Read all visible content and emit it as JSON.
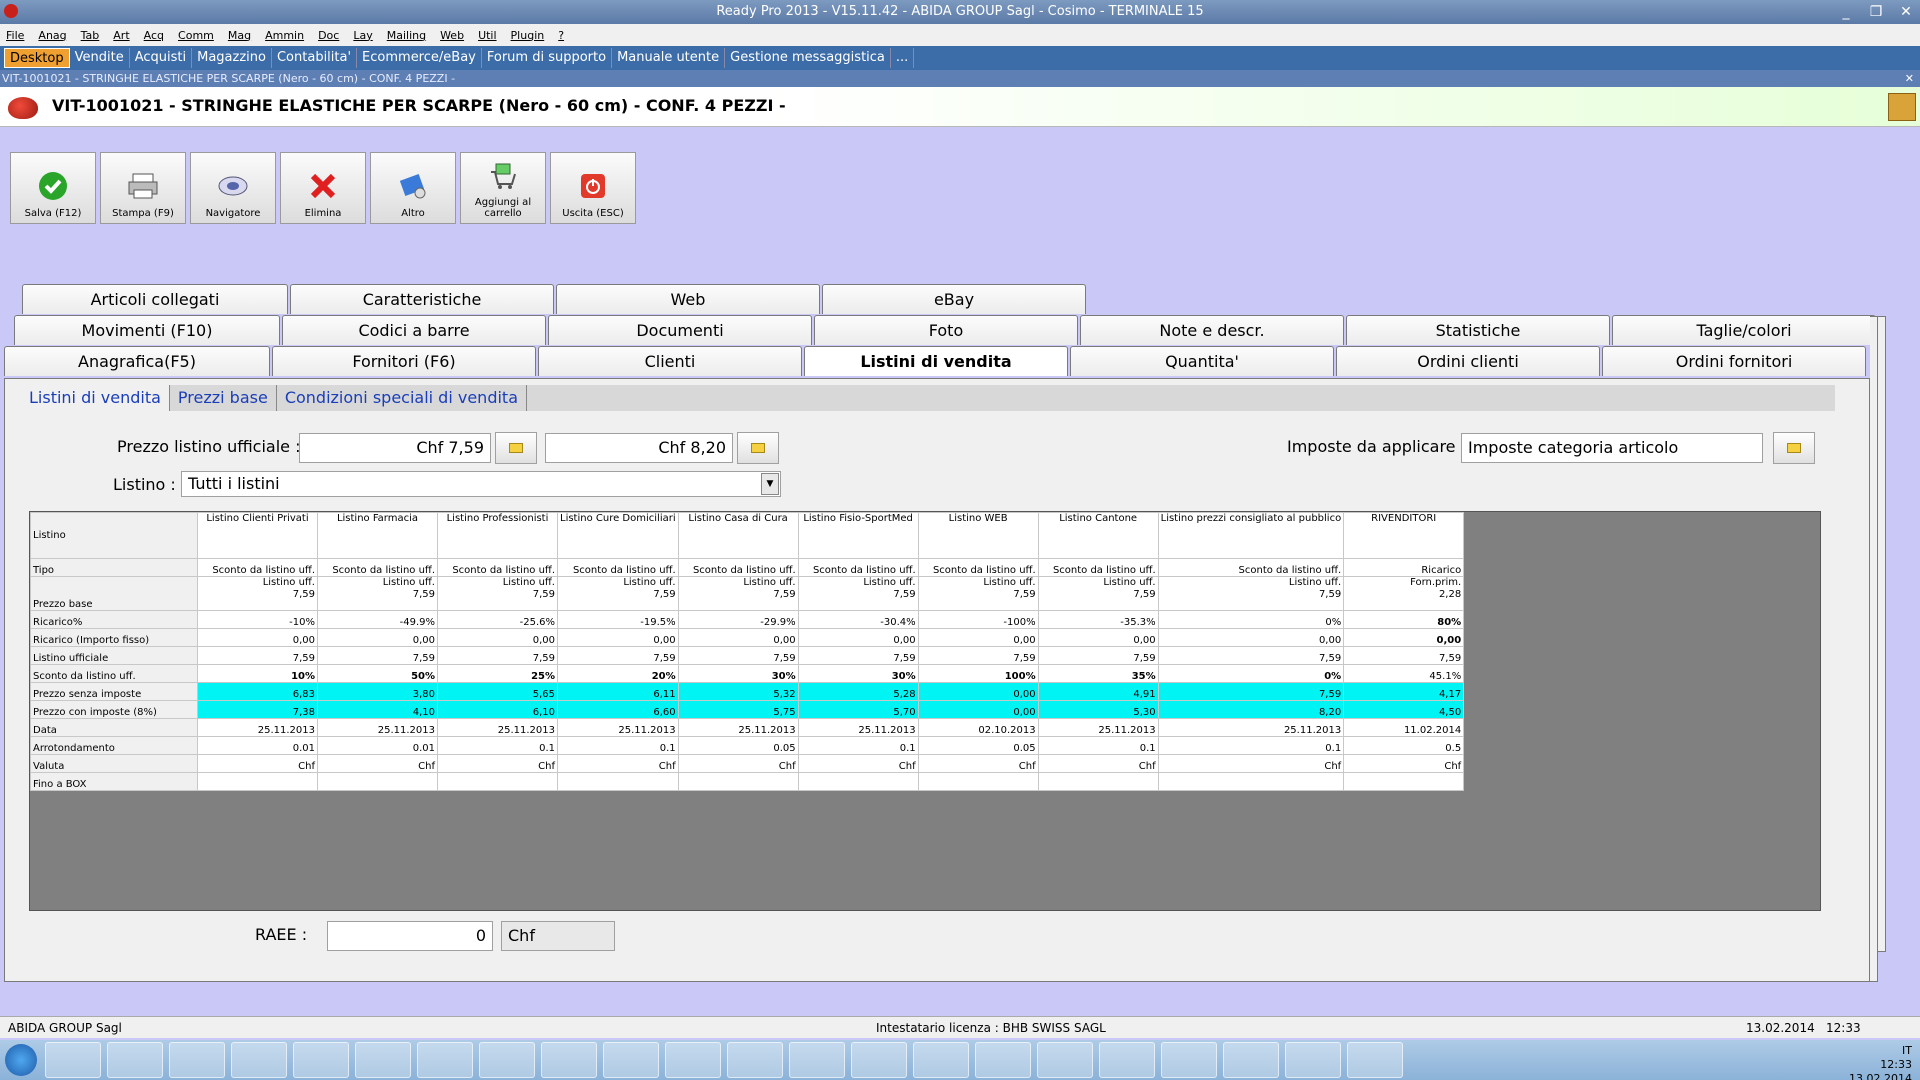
{
  "window": {
    "title": "Ready Pro 2013 - V15.11.42 - ABIDA GROUP Sagl - Cosimo - TERMINALE 15"
  },
  "menu": [
    "File",
    "Anag",
    "Tab",
    "Art",
    "Acq",
    "Comm",
    "Mag",
    "Ammin",
    "Doc",
    "Lay",
    "Mailing",
    "Web",
    "Util",
    "Plugin",
    "?"
  ],
  "quicktabs": [
    "Desktop",
    "Vendite",
    "Acquisti",
    "Magazzino",
    "Contabilita'",
    "Ecommerce/eBay",
    "Forum di supporto",
    "Manuale utente",
    "Gestione messaggistica",
    "..."
  ],
  "doc": {
    "small_title": "VIT-1001021 - STRINGHE ELASTICHE PER SCARPE (Nero - 60 cm) - CONF. 4 PEZZI -",
    "title": "VIT-1001021 - STRINGHE ELASTICHE PER SCARPE (Nero - 60 cm) - CONF. 4 PEZZI -"
  },
  "toolbar": [
    {
      "label": "Salva (F12)",
      "icon": "check-icon"
    },
    {
      "label": "Stampa (F9)",
      "icon": "printer-icon"
    },
    {
      "label": "Navigatore",
      "icon": "navigator-icon"
    },
    {
      "label": "Elimina",
      "icon": "delete-x-icon"
    },
    {
      "label": "Altro",
      "icon": "other-icon"
    },
    {
      "label": "Aggiungi al carrello",
      "icon": "cart-icon"
    },
    {
      "label": "Uscita (ESC)",
      "icon": "exit-icon"
    }
  ],
  "tabs": {
    "row1": [
      "Articoli collegati",
      "Caratteristiche",
      "Web",
      "eBay"
    ],
    "row2": [
      "Movimenti (F10)",
      "Codici a barre",
      "Documenti",
      "Foto",
      "Note e descr.",
      "Statistiche",
      "Taglie/colori"
    ],
    "row3": [
      "Anagrafica(F5)",
      "Fornitori (F6)",
      "Clienti",
      "Listini di vendita",
      "Quantita'",
      "Ordini clienti",
      "Ordini fornitori"
    ],
    "active": "Listini di vendita"
  },
  "subtabs": [
    "Listini di vendita",
    "Prezzi base",
    "Condizioni speciali di vendita"
  ],
  "form": {
    "prezzo_label": "Prezzo listino ufficiale :",
    "prezzo1": "Chf 7,59",
    "prezzo2": "Chf 8,20",
    "imposte_label": "Imposte da applicare :",
    "imposte_value": "Imposte categoria articolo",
    "listino_label": "Listino :",
    "listino_value": "Tutti i listini",
    "raee_label": "RAEE :",
    "raee_value": "0",
    "raee_currency": "Chf"
  },
  "grid": {
    "row_headers": [
      "Listino",
      "Tipo",
      "Prezzo base",
      "Ricarico%",
      "Ricarico (Importo fisso)",
      "Listino ufficiale",
      "Sconto da listino uff.",
      "Prezzo senza imposte",
      "Prezzo con imposte (8%)",
      "Data",
      "Arrotondamento",
      "Valuta",
      "Fino a BOX"
    ],
    "columns": [
      {
        "name": "Listino Clienti Privati",
        "tipo": "Sconto da listino uff.",
        "base1": "Listino uff.",
        "base2": "7,59",
        "ricarico": "-10%",
        "fisso": "0,00",
        "uff": "7,59",
        "sconto": "10%",
        "senza": "6,83",
        "con": "7,38",
        "data": "25.11.2013",
        "arr": "0.01",
        "valuta": "Chf"
      },
      {
        "name": "Listino Farmacia",
        "tipo": "Sconto da listino uff.",
        "base1": "Listino uff.",
        "base2": "7,59",
        "ricarico": "-49.9%",
        "fisso": "0,00",
        "uff": "7,59",
        "sconto": "50%",
        "senza": "3,80",
        "con": "4,10",
        "data": "25.11.2013",
        "arr": "0.01",
        "valuta": "Chf"
      },
      {
        "name": "Listino Professionisti",
        "tipo": "Sconto da listino uff.",
        "base1": "Listino uff.",
        "base2": "7,59",
        "ricarico": "-25.6%",
        "fisso": "0,00",
        "uff": "7,59",
        "sconto": "25%",
        "senza": "5,65",
        "con": "6,10",
        "data": "25.11.2013",
        "arr": "0.1",
        "valuta": "Chf"
      },
      {
        "name": "Listino Cure Domiciliari",
        "tipo": "Sconto da listino uff.",
        "base1": "Listino uff.",
        "base2": "7,59",
        "ricarico": "-19.5%",
        "fisso": "0,00",
        "uff": "7,59",
        "sconto": "20%",
        "senza": "6,11",
        "con": "6,60",
        "data": "25.11.2013",
        "arr": "0.1",
        "valuta": "Chf"
      },
      {
        "name": "Listino Casa di Cura",
        "tipo": "Sconto da listino uff.",
        "base1": "Listino uff.",
        "base2": "7,59",
        "ricarico": "-29.9%",
        "fisso": "0,00",
        "uff": "7,59",
        "sconto": "30%",
        "senza": "5,32",
        "con": "5,75",
        "data": "25.11.2013",
        "arr": "0.05",
        "valuta": "Chf"
      },
      {
        "name": "Listino Fisio-SportMed",
        "tipo": "Sconto da listino uff.",
        "base1": "Listino uff.",
        "base2": "7,59",
        "ricarico": "-30.4%",
        "fisso": "0,00",
        "uff": "7,59",
        "sconto": "30%",
        "senza": "5,28",
        "con": "5,70",
        "data": "25.11.2013",
        "arr": "0.1",
        "valuta": "Chf"
      },
      {
        "name": "Listino WEB",
        "tipo": "Sconto da listino uff.",
        "base1": "Listino uff.",
        "base2": "7,59",
        "ricarico": "-100%",
        "fisso": "0,00",
        "uff": "7,59",
        "sconto": "100%",
        "senza": "0,00",
        "con": "0,00",
        "data": "02.10.2013",
        "arr": "0.05",
        "valuta": "Chf"
      },
      {
        "name": "Listino Cantone",
        "tipo": "Sconto da listino uff.",
        "base1": "Listino uff.",
        "base2": "7,59",
        "ricarico": "-35.3%",
        "fisso": "0,00",
        "uff": "7,59",
        "sconto": "35%",
        "senza": "4,91",
        "con": "5,30",
        "data": "25.11.2013",
        "arr": "0.1",
        "valuta": "Chf"
      },
      {
        "name": "Listino prezzi consigliato al pubblico",
        "tipo": "Sconto da listino uff.",
        "base1": "Listino uff.",
        "base2": "7,59",
        "ricarico": "0%",
        "fisso": "0,00",
        "uff": "7,59",
        "sconto": "0%",
        "senza": "7,59",
        "con": "8,20",
        "data": "25.11.2013",
        "arr": "0.1",
        "valuta": "Chf"
      },
      {
        "name": "RIVENDITORI",
        "tipo": "Ricarico",
        "base1": "Forn.prim.",
        "base2": "2,28",
        "ricarico": "80%",
        "fisso": "0,00",
        "uff": "7,59",
        "sconto": "45.1%",
        "senza": "4,17",
        "con": "4,50",
        "data": "11.02.2014",
        "arr": "0.5",
        "valuta": "Chf"
      }
    ]
  },
  "status": {
    "company": "ABIDA GROUP Sagl",
    "license": "Intestatario licenza : BHB SWISS SAGL",
    "date": "13.02.2014",
    "time": "12:33"
  },
  "taskbar": {
    "apps": [
      "folder",
      "media",
      "web",
      "tool",
      "FZ",
      "XL",
      "W",
      "net",
      "PM",
      "pic",
      "gimp",
      "pdf",
      "tv",
      "ctrl",
      "fx",
      "mon",
      "chr",
      "berry",
      "card",
      "win",
      "sky",
      "pen"
    ],
    "lang": "IT",
    "clock": "12:33",
    "date": "13.02.2014"
  },
  "colors": {
    "highlight": "#00f4f4",
    "accent": "#f0a030",
    "bg": "#c9c8f6"
  }
}
